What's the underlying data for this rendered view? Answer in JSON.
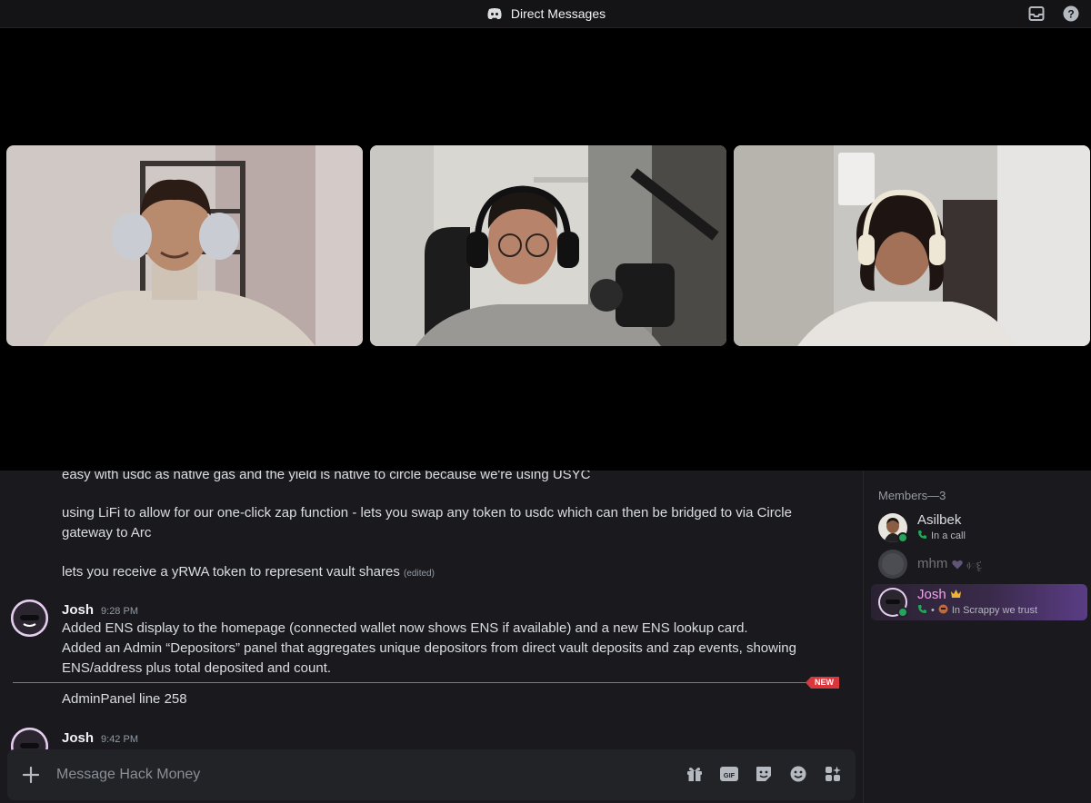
{
  "titlebar": {
    "title": "Direct Messages",
    "left_icon": "discord-logo-icon",
    "right_icons": [
      "inbox-icon",
      "help-icon"
    ]
  },
  "call": {
    "participants": [
      "participant-1-video",
      "participant-2-video",
      "participant-3-video"
    ]
  },
  "messages": {
    "prev_lines": [
      "easy with usdc as native gas and the yield is native to circle because we're using USYC",
      "using LiFi to allow for our one-click zap function - lets you swap any token to usdc which can then be bridged to via Circle gateway to Arc",
      "lets you receive a yRWA token to represent vault shares"
    ],
    "edited_label": "(edited)",
    "msg1": {
      "author": "Josh",
      "time": "9:28 PM",
      "line1": "Added ENS display to the homepage (connected wallet now shows ENS if available) and a new ENS lookup card.",
      "line2": "Added an Admin “Depositors” panel that aggregates unique depositors from direct vault deposits and zap events, showing ENS/address plus total deposited and count."
    },
    "new_badge": "NEW",
    "followup": "AdminPanel line 258",
    "msg2": {
      "author": "Josh",
      "time": "9:42 PM"
    }
  },
  "composer": {
    "placeholder": "Message Hack Money",
    "tools": [
      "gift-icon",
      "gif-icon",
      "sticker-icon",
      "emoji-icon",
      "apps-icon"
    ]
  },
  "members": {
    "heading": "Members—3",
    "list": [
      {
        "name": "Asilbek",
        "status": "In a call"
      },
      {
        "name": "mhm",
        "status": "ᰴદૃ"
      },
      {
        "name": "Josh",
        "status": "In Scrappy we trust"
      }
    ]
  },
  "colors": {
    "accent_green": "#23a55a",
    "new_red": "#da373c",
    "josh_name": "#f0a3e6"
  }
}
